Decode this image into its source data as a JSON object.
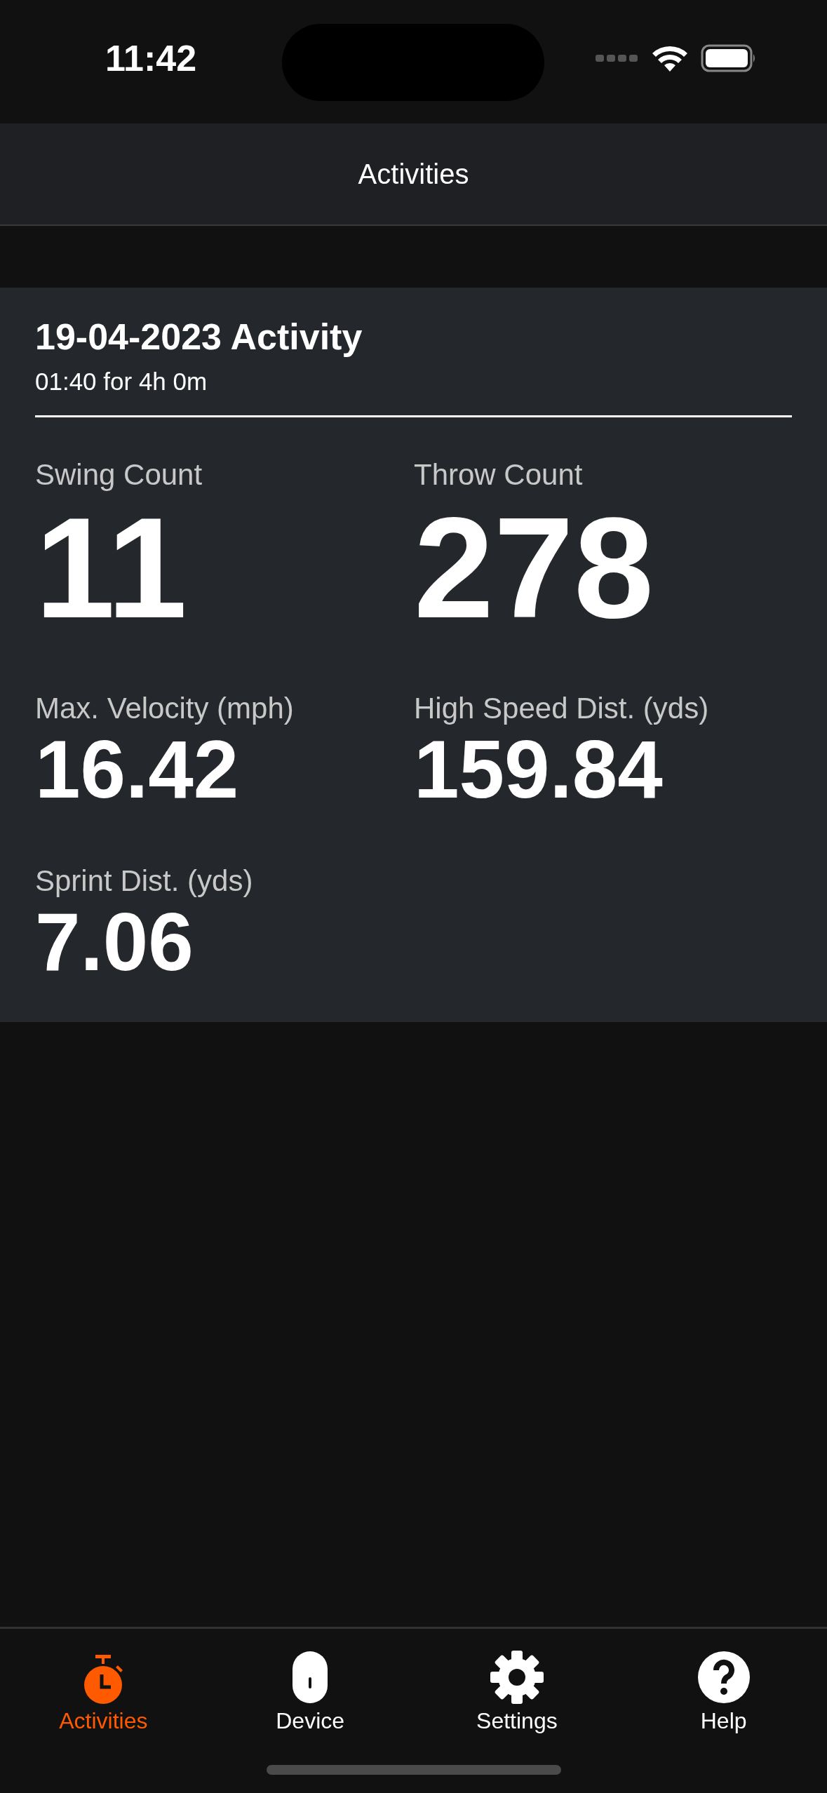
{
  "status_bar": {
    "time": "11:42"
  },
  "nav_bar": {
    "title": "Activities"
  },
  "activity": {
    "title": "19-04-2023 Activity",
    "subtitle": "01:40 for 4h 0m",
    "stats": [
      {
        "label": "Swing Count",
        "value": "11",
        "kind": "count"
      },
      {
        "label": "Throw Count",
        "value": "278",
        "kind": "count"
      },
      {
        "label": "Max. Velocity (mph)",
        "value": "16.42",
        "kind": "measure"
      },
      {
        "label": "High Speed Dist. (yds)",
        "value": "159.84",
        "kind": "measure"
      },
      {
        "label": "Sprint Dist. (yds)",
        "value": "7.06",
        "kind": "measure"
      }
    ]
  },
  "tab_bar": [
    {
      "label": "Activities",
      "kind": "stopwatch",
      "selected": true
    },
    {
      "label": "Device",
      "kind": "device",
      "selected": false
    },
    {
      "label": "Settings",
      "kind": "gear",
      "selected": false
    },
    {
      "label": "Help",
      "kind": "help",
      "selected": false
    }
  ]
}
